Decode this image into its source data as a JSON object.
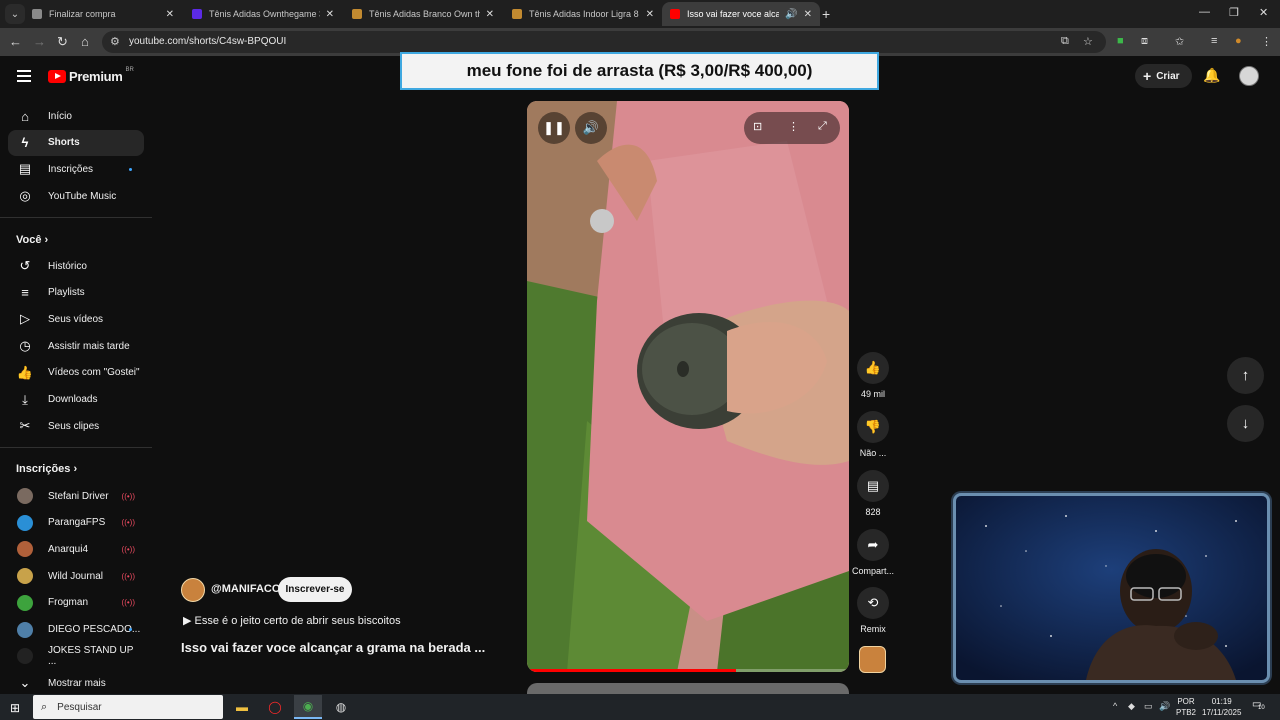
{
  "browser": {
    "tabs": [
      {
        "title": "Finalizar compra",
        "color": "#8a8a8a",
        "active": false
      },
      {
        "title": "Tênis Adidas Ownthegame 3.0 M",
        "color": "#5c2ae6",
        "active": false
      },
      {
        "title": "Tênis Adidas Branco Own the G",
        "color": "#c28a30",
        "active": false
      },
      {
        "title": "Tênis Adidas Indoor Ligra 8 Ma",
        "color": "#c28a30",
        "active": false
      },
      {
        "title": "Isso vai fazer voce alcançar",
        "color": "#ff0000",
        "active": true
      }
    ],
    "url": "youtube.com/shorts/C4sw-BPQOUI"
  },
  "header": {
    "logo_text": "Premium",
    "country_code": "BR",
    "create_label": "Criar"
  },
  "banner_text": "meu fone foi de arrasta (R$ 3,00/R$ 400,00)",
  "sidebar": {
    "main": [
      {
        "label": "Início",
        "icon": "home-icon",
        "glyph": "⌂"
      },
      {
        "label": "Shorts",
        "icon": "shorts-icon",
        "glyph": "ϟ"
      },
      {
        "label": "Inscrições",
        "icon": "subscriptions-icon",
        "glyph": "▤"
      },
      {
        "label": "YouTube Music",
        "icon": "music-icon",
        "glyph": "◎"
      }
    ],
    "you_heading": "Você",
    "you": [
      {
        "label": "Histórico",
        "icon": "history-icon",
        "glyph": "↺"
      },
      {
        "label": "Playlists",
        "icon": "playlists-icon",
        "glyph": "≡"
      },
      {
        "label": "Seus vídeos",
        "icon": "your-videos-icon",
        "glyph": "▷"
      },
      {
        "label": "Assistir mais tarde",
        "icon": "watch-later-icon",
        "glyph": "◷"
      },
      {
        "label": "Vídeos com \"Gostei\"",
        "icon": "liked-icon",
        "glyph": "👍"
      },
      {
        "label": "Downloads",
        "icon": "download-icon",
        "glyph": "⤓"
      },
      {
        "label": "Seus clipes",
        "icon": "scissors-icon",
        "glyph": "✂"
      }
    ],
    "subs_heading": "Inscrições",
    "subs": [
      {
        "label": "Stefani Driver",
        "color": "#7a6a60",
        "status": "live"
      },
      {
        "label": "ParangaFPS",
        "color": "#2a8fd6",
        "status": "live"
      },
      {
        "label": "Anarqui4",
        "color": "#b0603a",
        "status": "live"
      },
      {
        "label": "Wild Journal",
        "color": "#c8a24a",
        "status": "live"
      },
      {
        "label": "Frogman",
        "color": "#3da33d",
        "status": "live"
      },
      {
        "label": "DIEGO PESCADO...",
        "color": "#4f7fa8",
        "status": "dot"
      },
      {
        "label": "JOKES STAND UP ...",
        "color": "#222222",
        "status": "none"
      }
    ],
    "show_more": "Mostrar mais"
  },
  "video": {
    "progress": 0.65,
    "channel_handle": "@MANIFACO",
    "subscribe_label": "Inscrever-se",
    "song": "Esse é o jeito certo de abrir seus biscoitos",
    "title": "Isso vai  fazer voce alcançar a grama na berada ..."
  },
  "actions": {
    "likes": "49 mil",
    "dislike": "Não ...",
    "comments": "828",
    "share": "Compart...",
    "remix": "Remix"
  },
  "taskbar": {
    "search_placeholder": "Pesquisar",
    "lang_top": "POR",
    "lang_bottom": "PTB2",
    "time": "01:19",
    "date": "17/11/2025",
    "notif_count": "10"
  }
}
